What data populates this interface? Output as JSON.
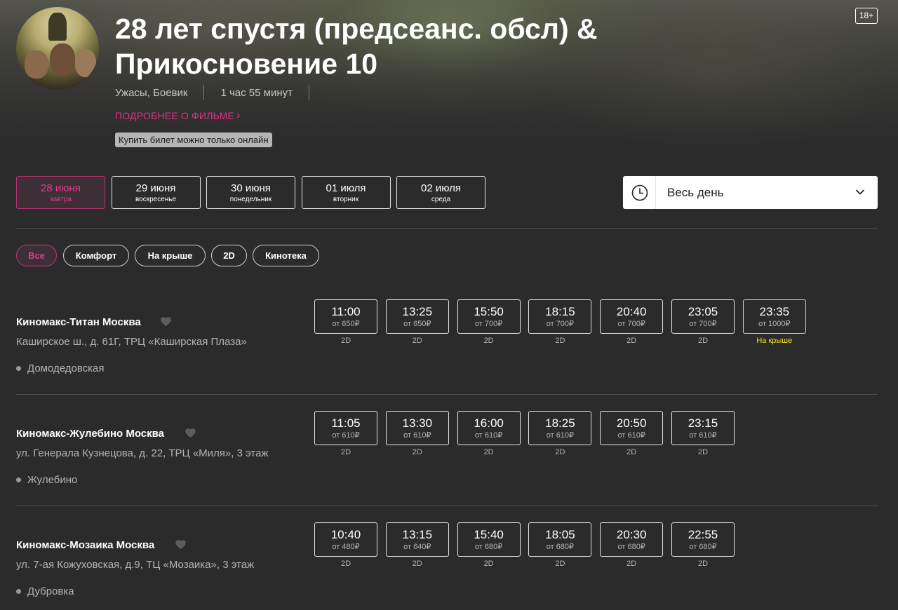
{
  "movie": {
    "title": "28 лет спустя (предсеанс. обсл) & Прикосновение 10",
    "age_rating": "18+",
    "genres": "Ужасы, Боевик",
    "duration": "1 час 55 минут",
    "more_link": "ПОДРОБНЕЕ О ФИЛЬМЕ",
    "online_note": "Купить билет можно только онлайн"
  },
  "dates": [
    {
      "day": "28 июня",
      "weekday": "завтра"
    },
    {
      "day": "29 июня",
      "weekday": "воскресенье"
    },
    {
      "day": "30 июня",
      "weekday": "понедельник"
    },
    {
      "day": "01 июля",
      "weekday": "вторник"
    },
    {
      "day": "02 июля",
      "weekday": "среда"
    }
  ],
  "time_filter": {
    "selected": "Весь день"
  },
  "filters": [
    "Все",
    "Комфорт",
    "На крыше",
    "2D",
    "Кинотека"
  ],
  "colors": {
    "accent": "#dc3f8c",
    "roof": "#f0e21f",
    "background": "#2b2b2c"
  },
  "cinemas": [
    {
      "name": "Киномакс-Титан Москва",
      "address": "Каширское ш., д. 61Г, ТРЦ «Каширская Плаза»",
      "metro": "Домодедовская",
      "sessions": [
        {
          "time": "11:00",
          "price": "от 650₽",
          "format": "2D"
        },
        {
          "time": "13:25",
          "price": "от 650₽",
          "format": "2D"
        },
        {
          "time": "15:50",
          "price": "от 700₽",
          "format": "2D"
        },
        {
          "time": "18:15",
          "price": "от 700₽",
          "format": "2D"
        },
        {
          "time": "20:40",
          "price": "от 700₽",
          "format": "2D"
        },
        {
          "time": "23:05",
          "price": "от 700₽",
          "format": "2D"
        },
        {
          "time": "23:35",
          "price": "от 1000₽",
          "format": "На крыше"
        }
      ]
    },
    {
      "name": "Киномакс-Жулебино Москва",
      "address": "ул. Генерала Кузнецова, д. 22, ТРЦ «Миля», 3 этаж",
      "metro": "Жулебино",
      "sessions": [
        {
          "time": "11:05",
          "price": "от 610₽",
          "format": "2D"
        },
        {
          "time": "13:30",
          "price": "от 610₽",
          "format": "2D"
        },
        {
          "time": "16:00",
          "price": "от 610₽",
          "format": "2D"
        },
        {
          "time": "18:25",
          "price": "от 610₽",
          "format": "2D"
        },
        {
          "time": "20:50",
          "price": "от 610₽",
          "format": "2D"
        },
        {
          "time": "23:15",
          "price": "от 610₽",
          "format": "2D"
        }
      ]
    },
    {
      "name": "Киномакс-Мозаика Москва",
      "address": "ул. 7-ая Кожуховская, д.9, ТЦ «Мозаика», 3 этаж",
      "metro": "Дубровка",
      "sessions": [
        {
          "time": "10:40",
          "price": "от 480₽",
          "format": "2D"
        },
        {
          "time": "13:15",
          "price": "от 640₽",
          "format": "2D"
        },
        {
          "time": "15:40",
          "price": "от 680₽",
          "format": "2D"
        },
        {
          "time": "18:05",
          "price": "от 680₽",
          "format": "2D"
        },
        {
          "time": "20:30",
          "price": "от 680₽",
          "format": "2D"
        },
        {
          "time": "22:55",
          "price": "от 680₽",
          "format": "2D"
        }
      ]
    }
  ]
}
